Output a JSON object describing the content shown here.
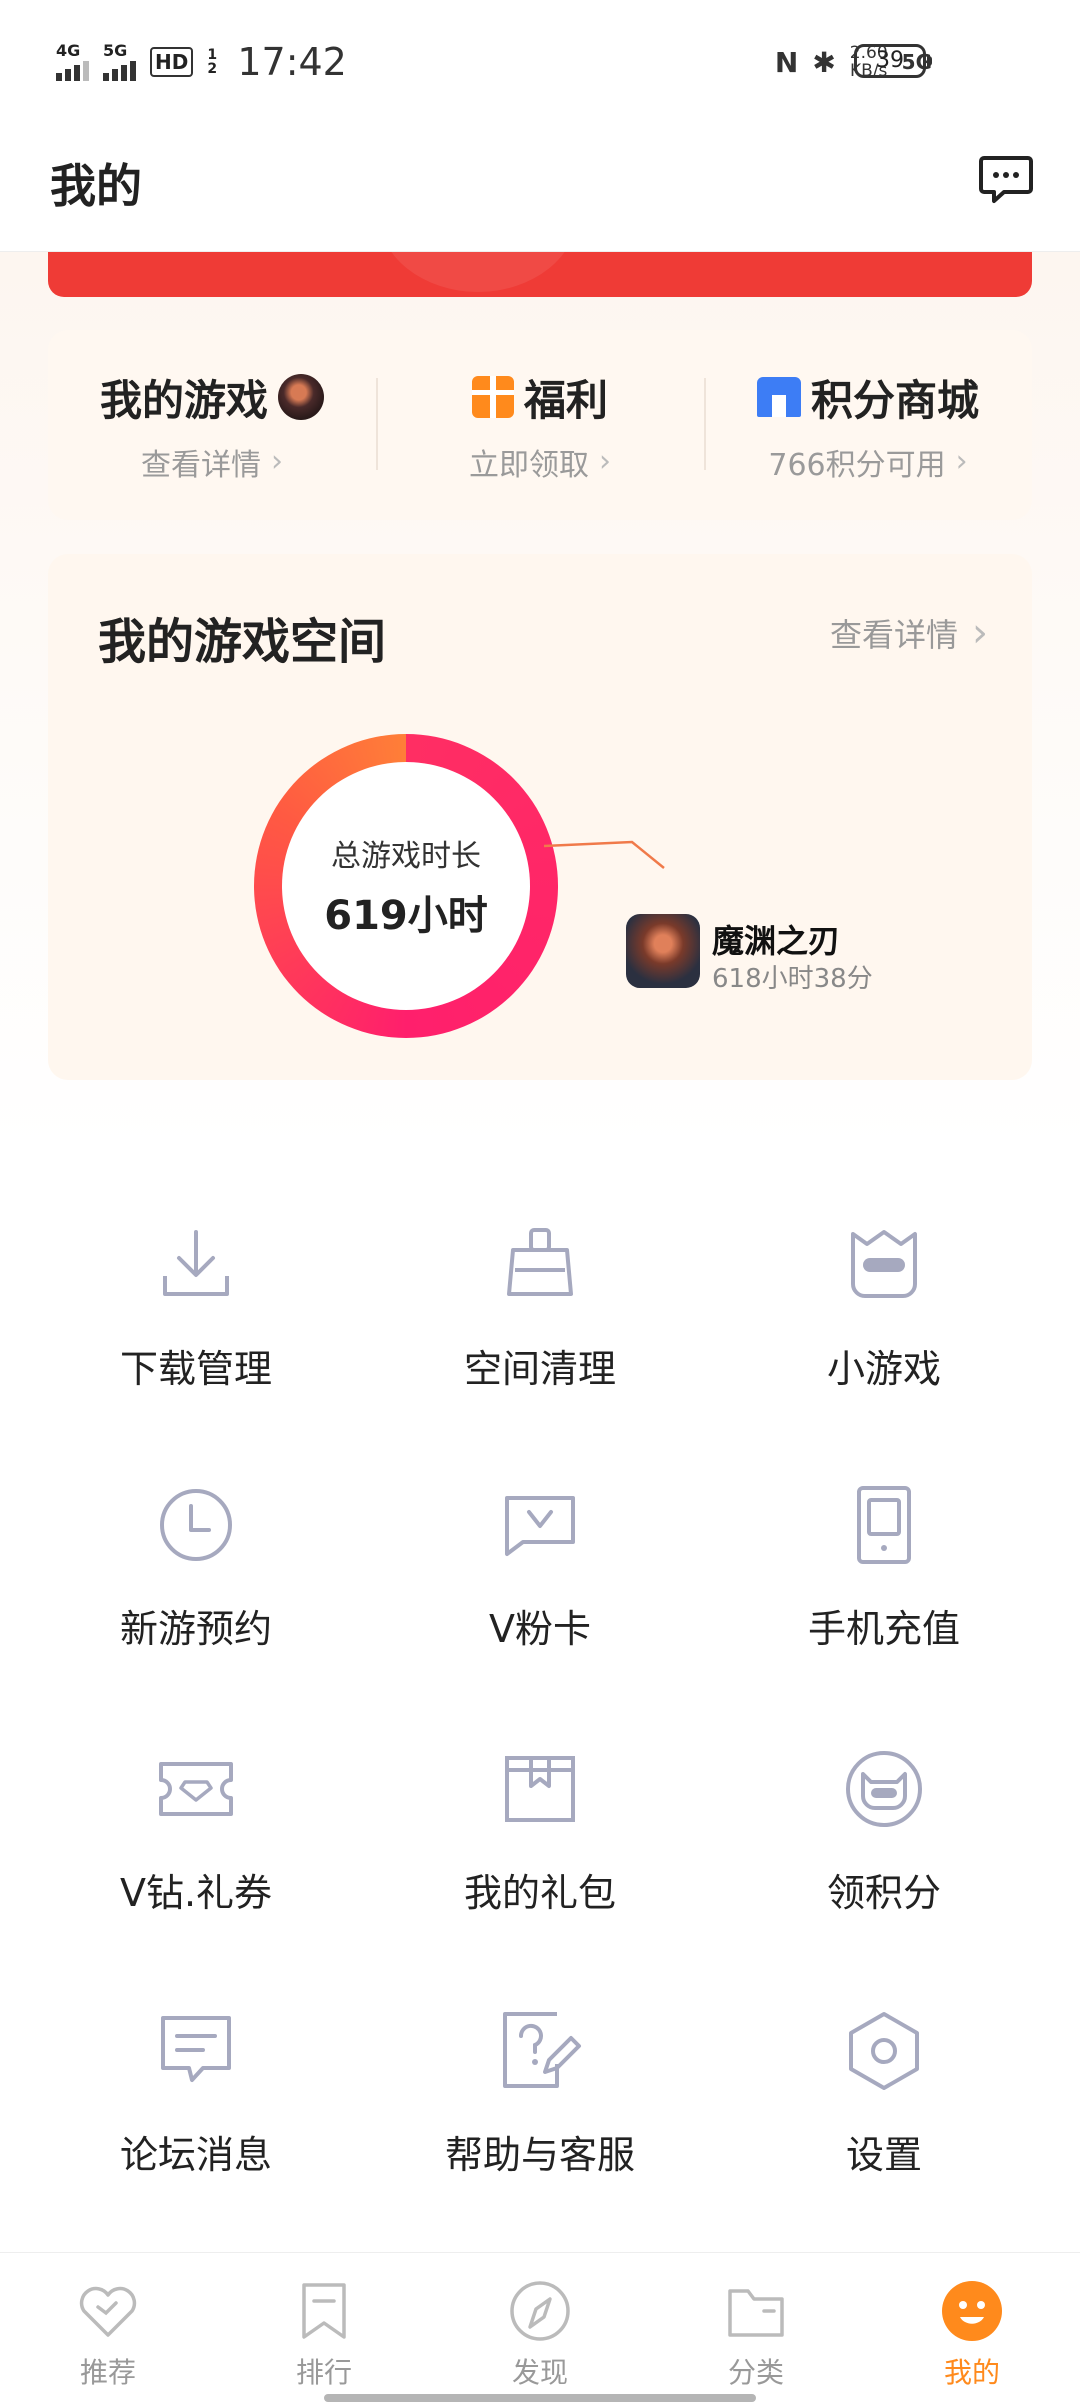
{
  "status_bar": {
    "sig1": "4G",
    "sig2": "5G",
    "hd": "HD",
    "hd_sub": "1 2",
    "time": "17:42",
    "speed_value": "2.60",
    "speed_unit": "KB/s",
    "net": "5G",
    "battery": "39"
  },
  "header": {
    "title": "我的"
  },
  "quick_links": [
    {
      "title": "我的游戏",
      "subtitle": "查看详情"
    },
    {
      "title": "福利",
      "subtitle": "立即领取"
    },
    {
      "title": "积分商城",
      "subtitle": "766积分可用"
    }
  ],
  "game_space": {
    "title": "我的游戏空间",
    "detail_label": "查看详情",
    "total_label": "总游戏时长",
    "total_value": "619小时",
    "game_name": "魔渊之刃",
    "game_time": "618小时38分"
  },
  "tools": [
    {
      "label": "下载管理",
      "icon": "download-icon"
    },
    {
      "label": "空间清理",
      "icon": "broom-icon"
    },
    {
      "label": "小游戏",
      "icon": "mini-game-icon"
    },
    {
      "label": "新游预约",
      "icon": "clock-icon"
    },
    {
      "label": "V粉卡",
      "icon": "v-card-icon"
    },
    {
      "label": "手机充值",
      "icon": "phone-icon"
    },
    {
      "label": "V钻.礼券",
      "icon": "coupon-icon"
    },
    {
      "label": "我的礼包",
      "icon": "gift-box-icon"
    },
    {
      "label": "领积分",
      "icon": "points-icon"
    },
    {
      "label": "论坛消息",
      "icon": "message-icon"
    },
    {
      "label": "帮助与客服",
      "icon": "help-icon"
    },
    {
      "label": "设置",
      "icon": "settings-icon"
    }
  ],
  "bottom_nav": [
    {
      "label": "推荐",
      "icon": "heart-icon",
      "active": false
    },
    {
      "label": "排行",
      "icon": "bookmark-icon",
      "active": false
    },
    {
      "label": "发现",
      "icon": "compass-icon",
      "active": false
    },
    {
      "label": "分类",
      "icon": "folder-icon",
      "active": false
    },
    {
      "label": "我的",
      "icon": "smile-icon",
      "active": true
    }
  ],
  "colors": {
    "accent": "#ff8a1c",
    "donut_start": "#ff7e38",
    "donut_end": "#ff1f6c",
    "banner": "#ef3b36",
    "icon_gray": "#a6a9bf"
  }
}
